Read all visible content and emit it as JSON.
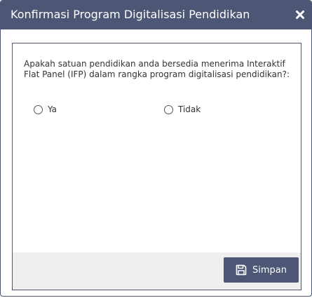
{
  "dialog": {
    "title": "Konfirmasi Program Digitalisasi Pendidikan",
    "close_icon": "close-icon"
  },
  "form": {
    "question": "Apakah satuan pendidikan anda bersedia menerima Interaktif Flat Panel (IFP) dalam rangka program digitalisasi pendidikan?:",
    "options": [
      {
        "label": "Ya",
        "selected": false
      },
      {
        "label": "Tidak",
        "selected": false
      }
    ]
  },
  "footer": {
    "save_label": "Simpan",
    "save_icon": "floppy-disk-icon"
  },
  "colors": {
    "header_bg": "#4d5674",
    "button_bg": "#4d5674",
    "footer_bg": "#efefef"
  }
}
